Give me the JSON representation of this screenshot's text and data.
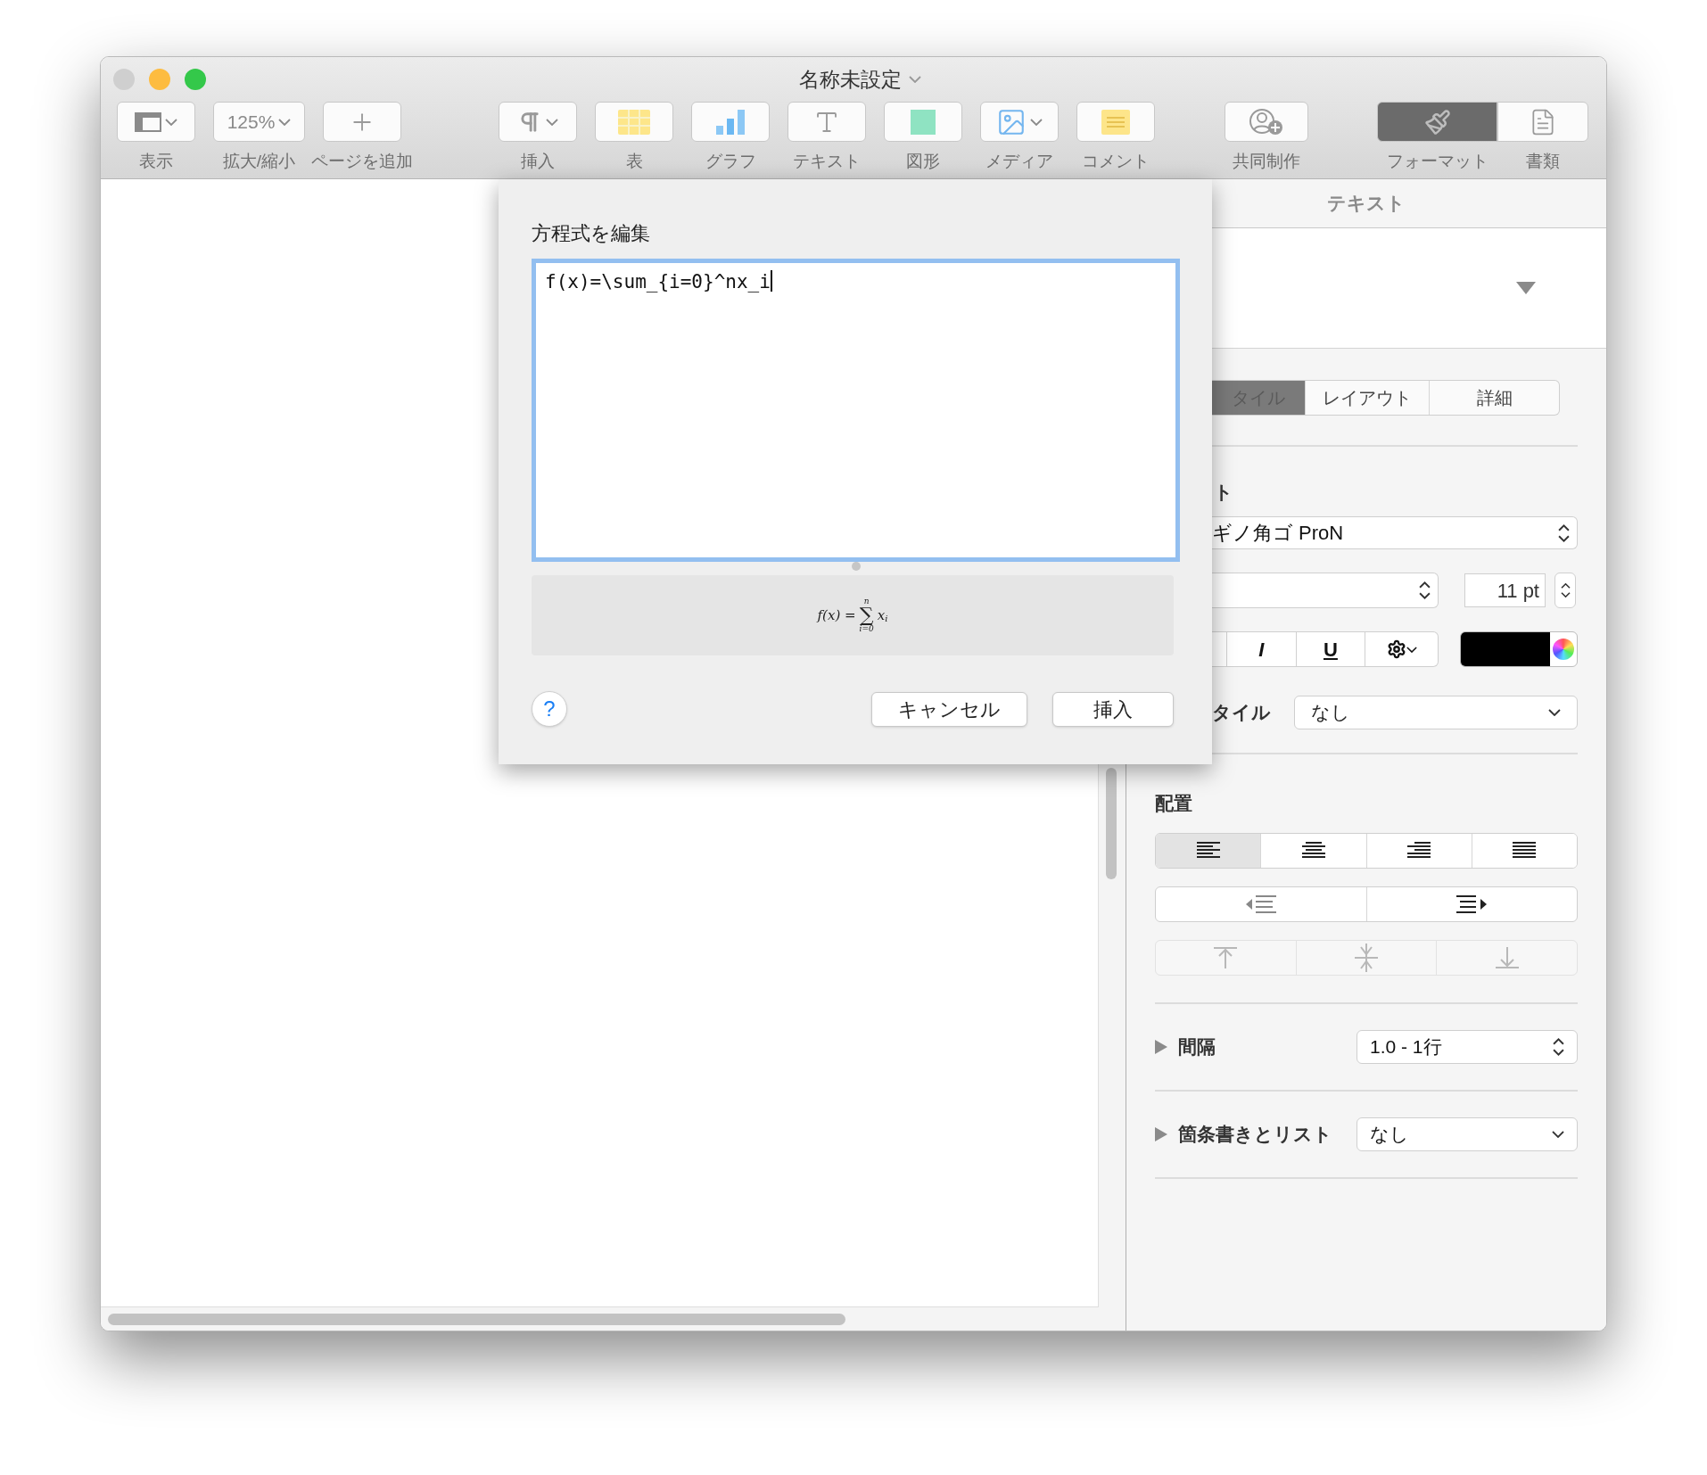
{
  "window": {
    "title": "名称未設定",
    "traffic_lights": [
      {
        "color": "#cfcfcf"
      },
      {
        "color": "#fdbc40"
      },
      {
        "color": "#34c84a"
      }
    ]
  },
  "toolbar": {
    "groups": [
      [
        {
          "kind": "view",
          "label": "表示",
          "menu": true,
          "selected": false
        },
        {
          "kind": "zoom",
          "label": "拡大/縮小",
          "value": "125%",
          "menu": true,
          "selected": false
        },
        {
          "kind": "add",
          "label": "ページを追加",
          "menu": false,
          "selected": false
        }
      ],
      [
        {
          "kind": "insert",
          "label": "挿入",
          "menu": true,
          "selected": false
        },
        {
          "kind": "table",
          "label": "表",
          "menu": false,
          "selected": false
        },
        {
          "kind": "chart",
          "label": "グラフ",
          "menu": false,
          "selected": false
        },
        {
          "kind": "text",
          "label": "テキスト",
          "menu": false,
          "selected": false
        },
        {
          "kind": "shape",
          "label": "図形",
          "menu": false,
          "selected": false
        },
        {
          "kind": "media",
          "label": "メディア",
          "menu": true,
          "selected": false
        },
        {
          "kind": "comment",
          "label": "コメント",
          "menu": false,
          "selected": false
        }
      ],
      [
        {
          "kind": "collaborate",
          "label": "共同制作",
          "menu": false,
          "selected": false
        }
      ],
      [
        {
          "kind": "format",
          "label": "フォーマット",
          "menu": false,
          "selected": true
        },
        {
          "kind": "document",
          "label": "書類",
          "menu": false,
          "selected": false
        }
      ]
    ]
  },
  "dialog": {
    "title": "方程式を編集",
    "equation": "f(x)=\\sum_{i=0}^nx_i",
    "preview": {
      "lhs": "f(x) =",
      "operator": "∑",
      "upper": "n",
      "lower": "i=0",
      "term": "x",
      "subscript": "i"
    },
    "help": "?",
    "buttons": [
      {
        "kind": "cancel",
        "label": "キャンセル"
      },
      {
        "kind": "default",
        "label": "挿入"
      }
    ]
  },
  "sidebar": {
    "header": "テキスト",
    "tabs": [
      {
        "label": "タイル",
        "selected": true
      },
      {
        "label": "レイアウト",
        "selected": false
      },
      {
        "label": "詳細",
        "selected": false
      }
    ],
    "font_title": "ト",
    "font_family": "ギノ角ゴ ProN",
    "font_size": "11 pt",
    "style_buttons": [
      {
        "kind": "italic",
        "label": "I"
      },
      {
        "kind": "underline",
        "label": "U"
      },
      {
        "kind": "gear"
      }
    ],
    "char_style_label": "タイル",
    "char_style": "なし",
    "alignment_title": "配置",
    "horizontal": [
      {
        "kind": "left",
        "selected": true
      },
      {
        "kind": "center",
        "selected": false
      },
      {
        "kind": "right",
        "selected": false
      },
      {
        "kind": "justify",
        "selected": false
      }
    ],
    "indent": [
      {
        "kind": "decrease",
        "disabled": false
      },
      {
        "kind": "increase",
        "disabled": false
      }
    ],
    "vertical": [
      {
        "kind": "top",
        "disabled": true
      },
      {
        "kind": "middle",
        "disabled": true
      },
      {
        "kind": "bottom",
        "disabled": true
      }
    ],
    "sections": [
      {
        "label": "間隔",
        "expanded": false,
        "value": "1.0 - 1行",
        "kind": "stepper"
      },
      {
        "label": "箇条書きとリスト",
        "expanded": false,
        "value": "なし",
        "kind": "dropdown"
      }
    ]
  }
}
